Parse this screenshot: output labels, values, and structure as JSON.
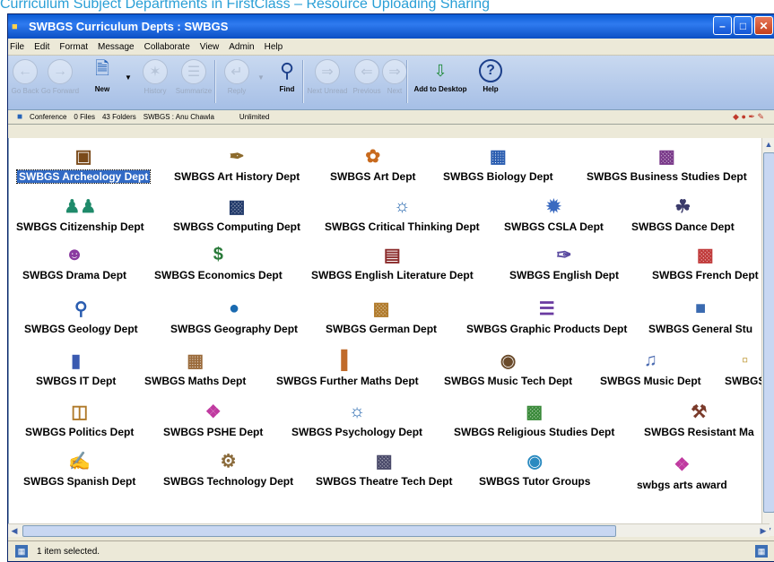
{
  "page_caption": "Curriculum Subject Departments in FirstClass – Resource Uploading Sharing",
  "window": {
    "title": "SWBGS Curriculum Depts : SWBGS"
  },
  "menu": [
    "File",
    "Edit",
    "Format",
    "Message",
    "Collaborate",
    "View",
    "Admin",
    "Help"
  ],
  "toolbar": {
    "go_back": "Go Back",
    "go_forward": "Go Forward",
    "new": "New",
    "history": "History",
    "summarize": "Summarize",
    "reply": "Reply",
    "find": "Find",
    "next_unread": "Next Unread",
    "previous": "Previous",
    "next": "Next",
    "add_to_desktop": "Add to Desktop",
    "help": "Help"
  },
  "status_info": {
    "conference": "Conference",
    "files": "0 Files",
    "folders": "43 Folders",
    "path": "SWBGS : Anu Chawla",
    "quota": "Unlimited"
  },
  "folders": [
    {
      "label": "SWBGS Archeology Dept",
      "icon": "chest-icon",
      "selected": true
    },
    {
      "label": "SWBGS Art History Dept",
      "icon": "quill-icon"
    },
    {
      "label": "SWBGS Art Dept",
      "icon": "palette-icon"
    },
    {
      "label": "SWBGS Biology Dept",
      "icon": "book-icon"
    },
    {
      "label": "SWBGS Business Studies Dept",
      "icon": "books-icon"
    },
    {
      "label": "SWBGS Citizenship Dept",
      "icon": "people-icon"
    },
    {
      "label": "SWBGS Computing Dept",
      "icon": "monitor-icon"
    },
    {
      "label": "SWBGS Critical Thinking Dept",
      "icon": "discussion-icon"
    },
    {
      "label": "SWBGS CSLA Dept",
      "icon": "globe-icon"
    },
    {
      "label": "SWBGS Dance Dept",
      "icon": "shoes-icon"
    },
    {
      "label": "SWBGS Drama Dept",
      "icon": "mask-icon"
    },
    {
      "label": "SWBGS Economics Dept",
      "icon": "money-icon"
    },
    {
      "label": "SWBGS English Literature Dept",
      "icon": "book-stack-icon"
    },
    {
      "label": "SWBGS English Dept",
      "icon": "pen-icon"
    },
    {
      "label": "SWBGS French Dept",
      "icon": "card-icon"
    },
    {
      "label": "SWBGS Geology Dept",
      "icon": "magnifier-icon"
    },
    {
      "label": "SWBGS Geography Dept",
      "icon": "earth-icon"
    },
    {
      "label": "SWBGS German Dept",
      "icon": "card-icon"
    },
    {
      "label": "SWBGS Graphic Products Dept",
      "icon": "layers-icon"
    },
    {
      "label": "SWBGS General Stu",
      "icon": "blocks-icon"
    },
    {
      "label": "SWBGS IT Dept",
      "icon": "computer-icon"
    },
    {
      "label": "SWBGS Maths Dept",
      "icon": "calculator-icon"
    },
    {
      "label": "SWBGS Further Maths Dept",
      "icon": "chart-icon"
    },
    {
      "label": "SWBGS Music Tech Dept",
      "icon": "speaker-icon"
    },
    {
      "label": "SWBGS Music Dept",
      "icon": "notes-icon"
    },
    {
      "label": "SWBGS",
      "icon": "folder-icon"
    },
    {
      "label": "SWBGS Politics Dept",
      "icon": "podium-icon"
    },
    {
      "label": "SWBGS PSHE Dept",
      "icon": "chat-icon"
    },
    {
      "label": "SWBGS Psychology Dept",
      "icon": "discussion-icon"
    },
    {
      "label": "SWBGS Religious Studies Dept",
      "icon": "books-icon"
    },
    {
      "label": "SWBGS Resistant Ma",
      "icon": "tools-icon"
    },
    {
      "label": "SWBGS Spanish Dept",
      "icon": "scroll-icon"
    },
    {
      "label": "SWBGS Technology Dept",
      "icon": "gear-icon"
    },
    {
      "label": "SWBGS Theatre Tech Dept",
      "icon": "clapper-icon"
    },
    {
      "label": "SWBGS Tutor Groups",
      "icon": "badge-icon"
    },
    {
      "label": "swbgs arts award",
      "icon": "chat-icon"
    }
  ],
  "statusbar": {
    "text": "1 item selected."
  }
}
